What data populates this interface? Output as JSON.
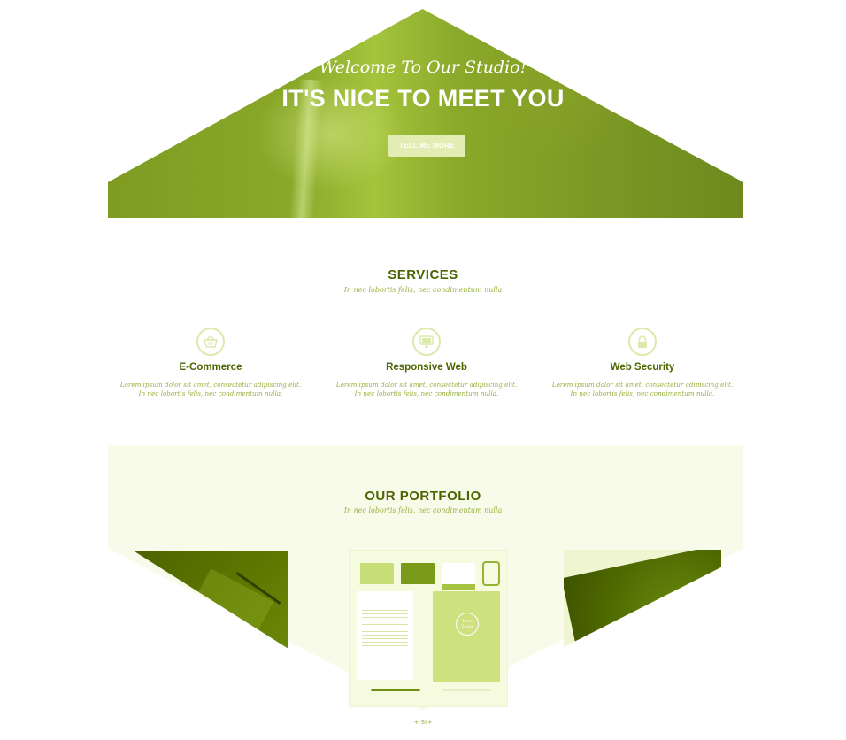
{
  "hero": {
    "welcome": "Welcome To Our Studio!",
    "title": "IT'S NICE TO MEET YOU",
    "button_label": "TELL ME MORE"
  },
  "services": {
    "title": "SERVICES",
    "subtitle": "In nec lobortis felis, nec condimentum nulla",
    "items": [
      {
        "icon": "basket-icon",
        "title": "E-Commerce",
        "text": "Lorem ipsum dolor sit amet, consectetur adipiscing elit. In nec lobortis felis, nec condimentum nulla."
      },
      {
        "icon": "monitor-icon",
        "title": "Responsive Web",
        "text": "Lorem ipsum dolor sit amet, consectetur adipiscing elit. In nec lobortis felis, nec condimentum nulla."
      },
      {
        "icon": "lock-icon",
        "title": "Web Security",
        "text": "Lorem ipsum dolor sit amet, consectetur adipiscing elit. In nec lobortis felis, nec condimentum nulla."
      }
    ]
  },
  "portfolio": {
    "title": "OUR PORTFOLIO",
    "subtitle": "In nec lobortis felis, nec condimentum nulla",
    "brand_mark": "Your Logo",
    "scroll_hint": "+ St+"
  },
  "colors": {
    "accent_dark": "#4c6500",
    "accent_light": "#97b23c",
    "hero_green": "#8aa92a",
    "button_bg": "#e2ecb3"
  }
}
